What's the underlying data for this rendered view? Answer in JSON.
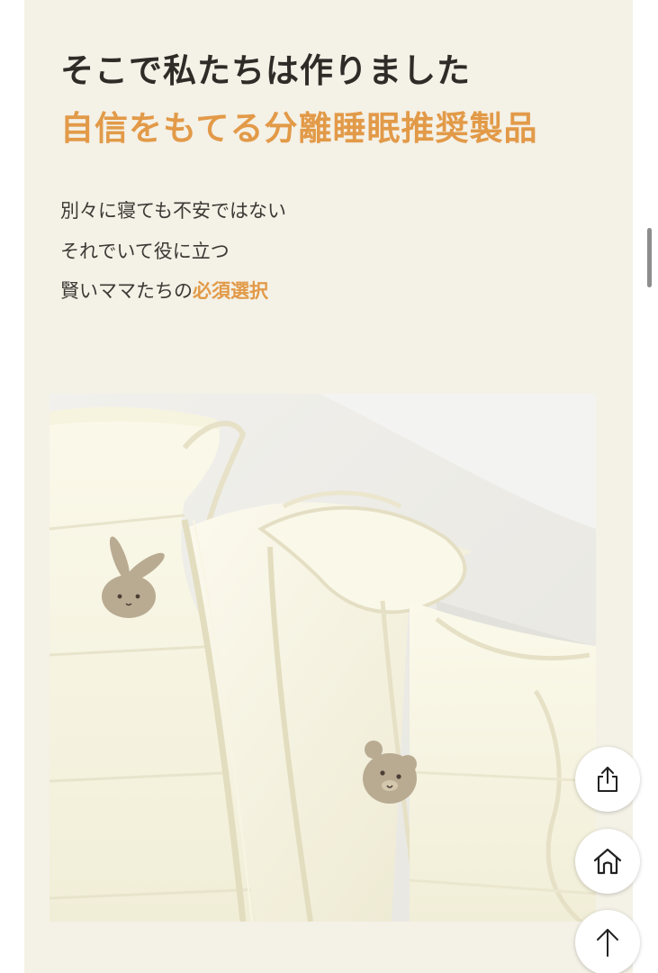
{
  "heading": {
    "line1": "そこで私たちは作りました",
    "line2": "自信をもてる分離睡眠推奨製品"
  },
  "body": {
    "line1": "別々に寝ても不安ではない",
    "line2": "それでいて役に立つ",
    "line3_prefix": "賢いママたちの",
    "line3_accent": "必須選択"
  },
  "colors": {
    "panel_background": "#f4f1e7",
    "heading_dark": "#2f2c28",
    "accent_orange": "#e29a48",
    "body_text": "#3c3935"
  },
  "photo": {
    "subject": "cream quilted baby sleep vests with rabbit and bear embroidery"
  },
  "floating_buttons": {
    "share_icon": "share-icon",
    "home_icon": "home-icon",
    "top_icon": "arrow-up-icon"
  },
  "scrollbar": {
    "position": 0.25
  }
}
